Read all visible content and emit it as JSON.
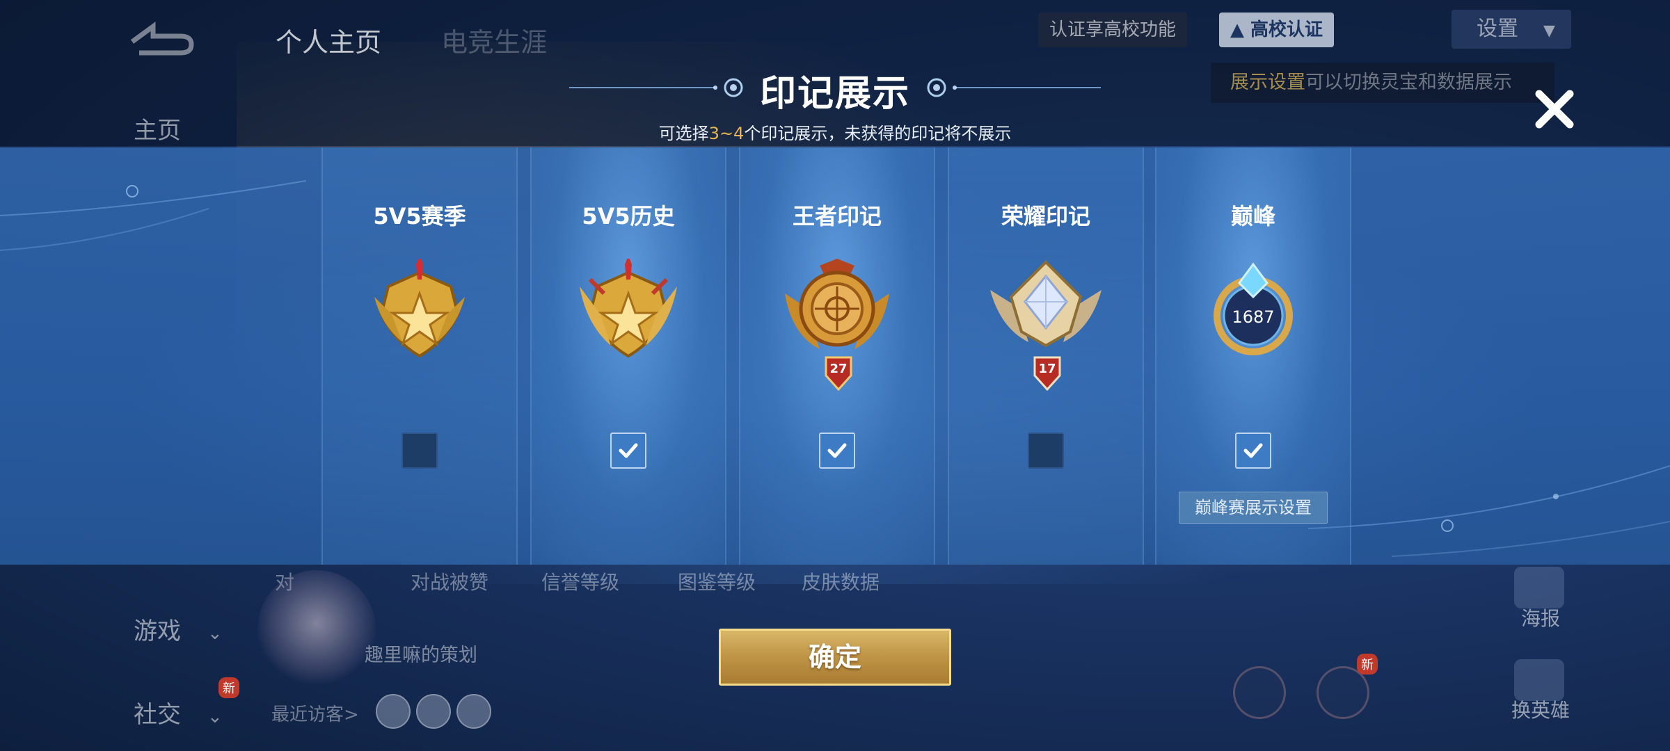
{
  "background": {
    "nav_tabs": [
      "个人主页",
      "电竞生涯"
    ],
    "certification": {
      "left": "认证享高校功能",
      "right": "高校认证"
    },
    "settings_label": "设置",
    "tip": {
      "highlight": "展示设置",
      "rest": "可以切换灵宝和数据展示"
    },
    "sidebar": [
      {
        "label": "主页"
      },
      {
        "label": "游戏"
      },
      {
        "label": "社交",
        "badge": "新"
      }
    ],
    "stats": [
      "对",
      "对战被赞",
      "信誉等级",
      "图鉴等级",
      "皮肤数据"
    ],
    "nickname": "趣里嘛的策划",
    "recent_visitors_label": "最近访客>",
    "right_actions": [
      {
        "label": "海报",
        "icon": "poster-icon"
      },
      {
        "label": "换英雄",
        "icon": "switch-hero-icon"
      }
    ],
    "new_badge": "新"
  },
  "modal": {
    "title": "印记展示",
    "subtitle": {
      "prefix": "可选择",
      "range": "3~4",
      "suffix": "个印记展示，未获得的印记将不展示"
    },
    "confirm_label": "确定",
    "columns": [
      {
        "title": "5V5赛季",
        "badge": "gold-star-badge-icon",
        "checked": false
      },
      {
        "title": "5V5历史",
        "badge": "gold-star-badge-icon",
        "checked": true
      },
      {
        "title": "王者印记",
        "badge": "king-mark-badge-icon",
        "number": "27",
        "checked": true
      },
      {
        "title": "荣耀印记",
        "badge": "glory-mark-badge-icon",
        "number": "17",
        "checked": false
      },
      {
        "title": "巅峰",
        "badge": "peak-badge-icon",
        "number": "1687",
        "checked": true,
        "extra_button": "巅峰赛展示设置"
      }
    ]
  },
  "colors": {
    "panel": "#3a6fb0",
    "gold_text": "#e8b84e",
    "confirm_button": "#c49a4c",
    "checkbox_on": "#3d7bc4",
    "checkbox_off": "#1e3d66"
  }
}
